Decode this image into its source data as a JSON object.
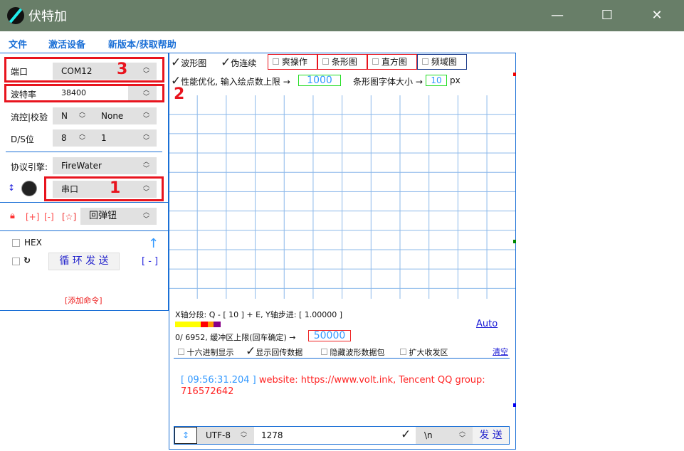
{
  "window": {
    "title": "伏特加",
    "minimize": "—",
    "maximize": "☐",
    "close": "✕"
  },
  "menu": [
    "文件",
    "激活设备",
    "新版本/获取帮助"
  ],
  "serial": {
    "port_label": "端口",
    "port_value": "COM12",
    "baud_label": "波特率",
    "baud_value": "38400",
    "flow_label": "流控|校验",
    "flow_value": "N",
    "parity_value": "None",
    "ds_label": "D/S位",
    "data_bits": "8",
    "stop_bits": "1",
    "engine_label": "协议引擎:",
    "engine_value": "FireWater",
    "conn_value": "串口",
    "conn_icon": "↕"
  },
  "annotations": [
    "3",
    "2",
    "1"
  ],
  "buttons_row": {
    "plus": "[+]",
    "minus": "[-]",
    "star": "[☆]",
    "mode_value": "回弹钮"
  },
  "command": {
    "hex_label": "HEX",
    "loop_icon": "↻",
    "loop_send": "循 环 发 送",
    "up_icon": "↑",
    "remove": "[ - ]",
    "add_command": "[添加命令]"
  },
  "view_tabs": [
    {
      "label": "波形图",
      "checked": true
    },
    {
      "label": "伪连续",
      "checked": true
    },
    {
      "label": "爽操作",
      "checked": false
    },
    {
      "label": "条形图",
      "checked": false
    },
    {
      "label": "直方图",
      "checked": false
    },
    {
      "label": "频域图",
      "checked": false
    }
  ],
  "perf": {
    "label": "性能优化, 输入绘点数上限 →",
    "value": "1000",
    "font_label": "条形图字体大小 →",
    "font_value": "10",
    "unit": "px"
  },
  "axis": {
    "text": "X轴分段: Q - [ 10 ] + E,  Y轴步进: [ 1.00000 ]",
    "auto": "Auto"
  },
  "colors": {
    "bar": [
      "#ffff00",
      "#ff0000",
      "#ff9900",
      "#800080"
    ],
    "accent": "#1a6fd6",
    "red": "#e8141e"
  },
  "buffer": {
    "text": "0/ 6952, 缓冲区上限(回车确定) →",
    "value": "50000"
  },
  "options": [
    {
      "label": "十六进制显示",
      "checked": false
    },
    {
      "label": "显示回传数据",
      "checked": true
    },
    {
      "label": "隐藏波形数据包",
      "checked": false
    },
    {
      "label": "扩大收发区",
      "checked": false
    }
  ],
  "clear": "清空",
  "log": {
    "time": "[ 09:56:31.204 ]",
    "message": "website: https://www.volt.ink, Tencent QQ group: 716572642"
  },
  "send": {
    "icon": "↕",
    "encoding": "UTF-8",
    "input": "1278",
    "ending": "\\n",
    "send": "发 送"
  }
}
